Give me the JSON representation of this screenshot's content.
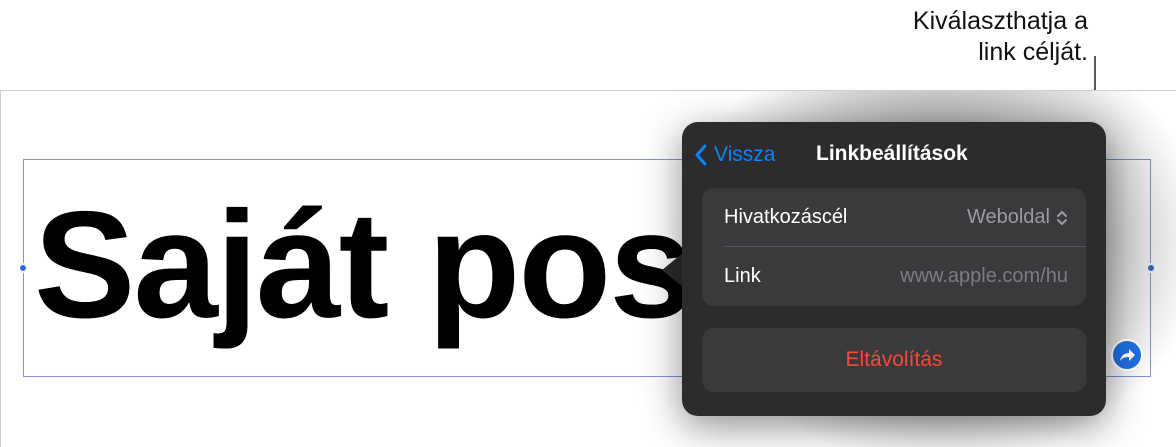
{
  "callout": {
    "line1": "Kiválaszthatja a",
    "line2": "link célját."
  },
  "document": {
    "title_text": "Saját poszt ó"
  },
  "popover": {
    "back_label": "Vissza",
    "title": "Linkbeállítások",
    "rows": [
      {
        "label": "Hivatkozáscél",
        "value": "Weboldal"
      },
      {
        "label": "Link",
        "value": "www.apple.com/hu"
      }
    ],
    "remove_label": "Eltávolítás"
  },
  "icons": {
    "back": "chevron-left-icon",
    "selector": "chevron-up-down-icon",
    "link_badge": "arrow-link-icon"
  },
  "colors": {
    "accent": "#0a84ff",
    "destructive": "#ff453a",
    "selection": "#2c6fe0",
    "popover_bg": "#2c2c2e"
  }
}
